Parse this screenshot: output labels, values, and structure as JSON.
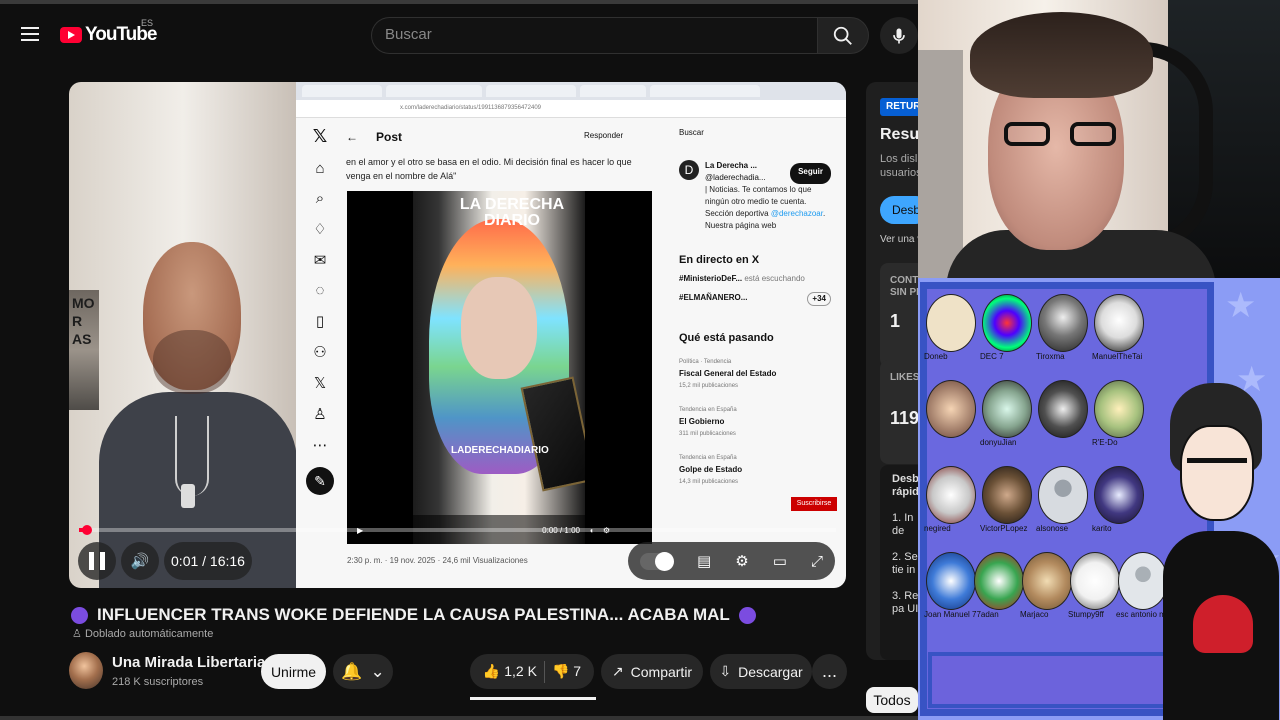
{
  "browser": {
    "brand": "YouTube",
    "region": "ES",
    "search_placeholder": "Buscar"
  },
  "player": {
    "time": "0:01 / 16:16",
    "progress": 0.001,
    "embedded_x": {
      "post_header": "Post",
      "reply_label": "Responder",
      "search_label": "Buscar",
      "post_text": "en el amor y el otro se basa en el odio. Mi decisión final es hacer lo que venga en el nombre de Alá\"",
      "brand_top": "LA DERECHA",
      "brand_bottom": "DIARIO",
      "handle": "LADERECHADIARIO",
      "mini_time": "0:00 / 1:00",
      "account_name": "La Derecha ...",
      "account_handle": "@laderechadia...",
      "follow_label": "Seguir",
      "bio": "| Noticias. Te contamos lo que ningún otro medio te cuenta. Sección deportiva",
      "bio_link": "@derechazoar",
      "bio_end": ". Nuestra página web",
      "live_title": "En directo en X",
      "live_one": "#MinisterioDeF...",
      "live_one_suffix": "está escuchando",
      "live_two": "#ELMAÑANERO...",
      "live_count": "+34",
      "trending_title": "Qué está pasando",
      "trend_1_cat": "Política · Tendencia",
      "trend_1": "Fiscal General del Estado",
      "trend_1_count": "15,2 mil publicaciones",
      "trend_2_cat": "Tendencia en España",
      "trend_2": "El Gobierno",
      "trend_2_count": "311 mil publicaciones",
      "trend_3_cat": "Tendencia en España",
      "trend_3": "Golpe de Estado",
      "trend_3_count": "14,3 mil publicaciones",
      "subscribe": "Suscribirse",
      "timestamp": "2:30 p. m. · 19 nov. 2025 · 24,6 mil Visualizaciones",
      "url": "x.com/laderechadiario/status/1991136879356472409"
    },
    "room_text": "MO\nR\nAS"
  },
  "video": {
    "title": "INFLUENCER TRANS WOKE DEFIENDE LA CAUSA PALESTINA... ACABA MAL",
    "dubbed": "Doblado automáticamente",
    "channel": "Una Mirada Libertaria",
    "subscribers": "218 K suscriptores",
    "join": "Unirme",
    "likes": "1,2 K",
    "dislikes": "7",
    "share": "Compartir",
    "download": "Descargar",
    "more": "...",
    "filter": "Todos"
  },
  "side_panel": {
    "badge": "RETUR",
    "title": "Resum",
    "text": "Los disl usuarios",
    "button": "Desb",
    "link": "Ver una v",
    "card1_label": "CONTE SIN PE",
    "card1_value": "1",
    "card2_label": "LIKES",
    "card2_value": "119",
    "list_title": "Desbl rápido",
    "list_items": [
      "1. In de",
      "2. Se tie in",
      "3. Re pa UI"
    ]
  },
  "overlay": {
    "avatar_names": [
      "Doneb",
      "DEC 7",
      "Tiroxma",
      "ManuelTheTai",
      "",
      "donyuJian",
      "",
      "R'E-Do",
      "negired",
      "VictorPLopez",
      "alsonose",
      "karito",
      "Joan Manuel",
      "77adan",
      "Marjaco",
      "Stumpy9ff",
      "esc antonio morti"
    ]
  },
  "colors": {
    "youtube_red": "#ff0033",
    "purple_dot": "#7b4ce0",
    "overlay_blue": "#8b9cf5"
  }
}
